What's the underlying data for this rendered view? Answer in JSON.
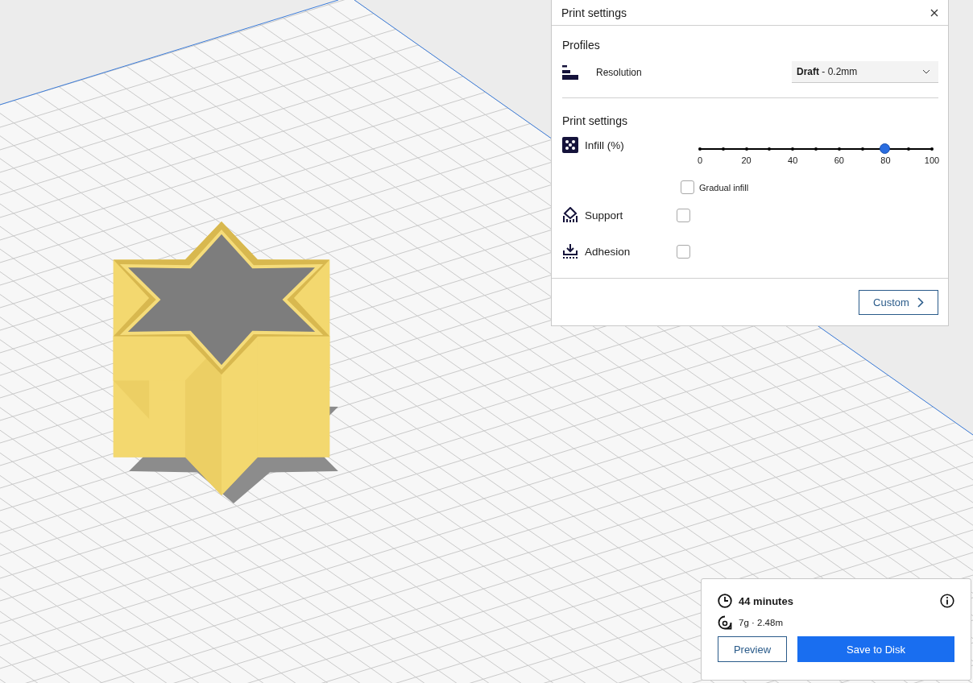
{
  "print_panel": {
    "title": "Print settings",
    "profiles": {
      "heading": "Profiles",
      "resolution": {
        "label": "Resolution",
        "value": "**Draft** - 0.2mm"
      }
    },
    "settings": {
      "heading": "Print settings",
      "infill": {
        "label": "Infill (%)",
        "level": 0.8,
        "tick_labels": [
          "0",
          "20",
          "40",
          "60",
          "80",
          "100"
        ]
      },
      "gradual_infill": {
        "label": "Gradual infill",
        "checked": false
      },
      "support": {
        "label": "Support",
        "checked": false
      },
      "adhesion": {
        "label": "Adhesion",
        "checked": false
      }
    },
    "custom_button": "Custom"
  },
  "summary": {
    "time": "44 minutes",
    "material": "7g · 2.48m",
    "buttons": [
      {
        "label": "Preview",
        "kind": "secondary"
      },
      {
        "label": "Save to Disk",
        "kind": "primary"
      }
    ]
  }
}
